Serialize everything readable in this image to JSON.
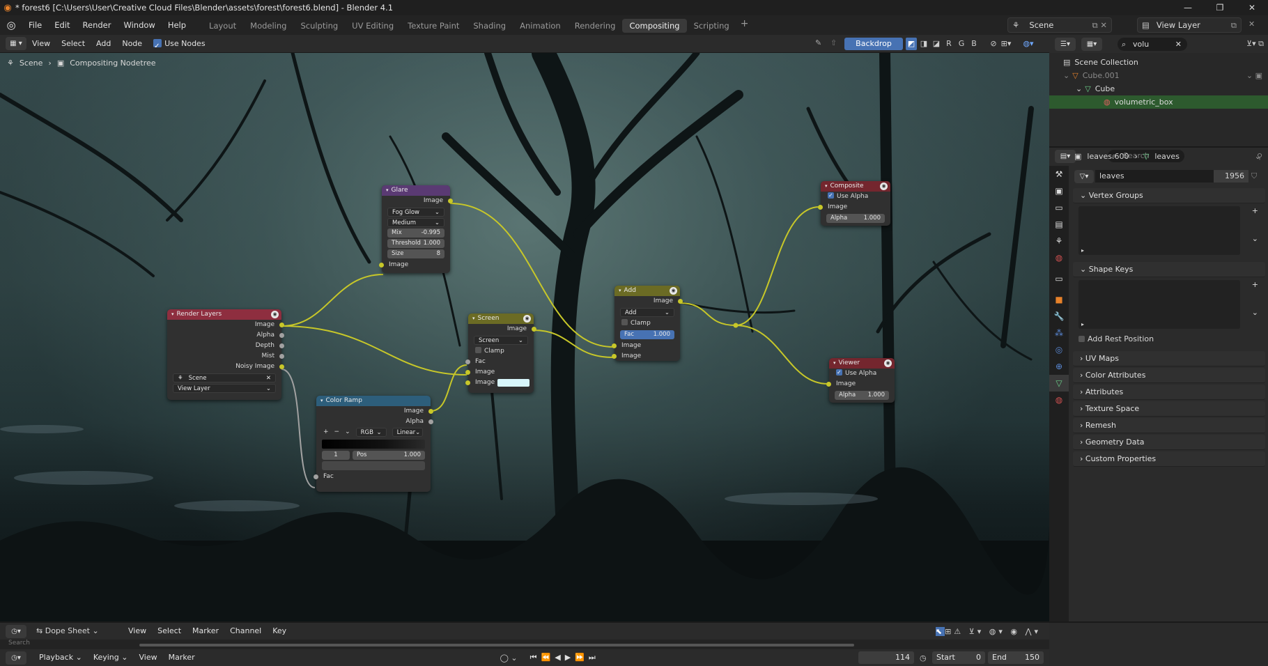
{
  "window": {
    "title": "* forest6 [C:\\Users\\User\\Creative Cloud Files\\Blender\\assets\\forest\\forest6.blend] - Blender 4.1",
    "controls": [
      "—",
      "❐",
      "✕"
    ]
  },
  "topbar": {
    "menus": [
      "File",
      "Edit",
      "Render",
      "Window",
      "Help"
    ],
    "workspaces": [
      "Layout",
      "Modeling",
      "Sculpting",
      "UV Editing",
      "Texture Paint",
      "Shading",
      "Animation",
      "Rendering",
      "Compositing",
      "Scripting"
    ],
    "active_workspace": "Compositing",
    "scene": "Scene",
    "view_layer": "View Layer"
  },
  "node_header": {
    "menus": [
      "View",
      "Select",
      "Add",
      "Node"
    ],
    "use_nodes_label": "Use Nodes",
    "backdrop_label": "Backdrop",
    "channels": [
      "R",
      "G",
      "B"
    ]
  },
  "breadcrumb": {
    "scene": "Scene",
    "tree": "Compositing Nodetree"
  },
  "nodes": {
    "glare": {
      "title": "Glare",
      "out_image": "Image",
      "type": "Fog Glow",
      "quality": "Medium",
      "mix_label": "Mix",
      "mix_value": "-0.995",
      "threshold_label": "Threshold",
      "threshold_value": "1.000",
      "size_label": "Size",
      "size_value": "8",
      "in_image": "Image"
    },
    "render_layers": {
      "title": "Render Layers",
      "outputs": [
        "Image",
        "Alpha",
        "Depth",
        "Mist",
        "Noisy Image"
      ],
      "scene": "Scene",
      "layer": "View Layer"
    },
    "screen": {
      "title": "Screen",
      "out_image": "Image",
      "mode": "Screen",
      "clamp": "Clamp",
      "in_fac": "Fac",
      "in_image1": "Image",
      "in_image2": "Image"
    },
    "color_ramp": {
      "title": "Color Ramp",
      "out_image": "Image",
      "out_alpha": "Alpha",
      "mode": "RGB",
      "interp": "Linear",
      "index": "1",
      "pos_label": "Pos",
      "pos_value": "1.000",
      "in_fac": "Fac"
    },
    "add": {
      "title": "Add",
      "out_image": "Image",
      "mode": "Add",
      "clamp": "Clamp",
      "fac_label": "Fac",
      "fac_value": "1.000",
      "in_image1": "Image",
      "in_image2": "Image"
    },
    "composite": {
      "title": "Composite",
      "use_alpha": "Use Alpha",
      "in_image": "Image",
      "alpha_label": "Alpha",
      "alpha_value": "1.000"
    },
    "viewer": {
      "title": "Viewer",
      "use_alpha": "Use Alpha",
      "in_image": "Image",
      "alpha_label": "Alpha",
      "alpha_value": "1.000"
    }
  },
  "outliner": {
    "search": "volu",
    "items": [
      {
        "label": "Scene Collection"
      },
      {
        "label": "Cube.001"
      },
      {
        "label": "Cube"
      },
      {
        "label": "volumetric_box"
      }
    ]
  },
  "properties": {
    "search_placeholder": "Search",
    "breadcrumb_object": "leaves.600",
    "breadcrumb_data": "leaves",
    "mesh_name": "leaves",
    "mesh_users": "1956",
    "vertex_groups": "Vertex Groups",
    "shape_keys": "Shape Keys",
    "add_rest_position": "Add Rest Position",
    "panels": [
      "UV Maps",
      "Color Attributes",
      "Attributes",
      "Texture Space",
      "Remesh",
      "Geometry Data",
      "Custom Properties"
    ]
  },
  "timeline": {
    "editor": "Dope Sheet",
    "menus": [
      "View",
      "Select",
      "Marker",
      "Channel",
      "Key"
    ],
    "search_placeholder": "Search",
    "bottom_menus": [
      "Playback",
      "Keying",
      "View",
      "Marker"
    ],
    "current_frame": "114",
    "start_label": "Start",
    "start_value": "0",
    "end_label": "End",
    "end_value": "150"
  },
  "colors": {
    "accent": "#4772b3",
    "glare_header": "#5a3a73",
    "render_layers_header": "#8e2e3f",
    "screen_header": "#6b6b24",
    "color_ramp_header": "#2d5e7b",
    "composite_header": "#74262e",
    "link": "#c7c729"
  }
}
